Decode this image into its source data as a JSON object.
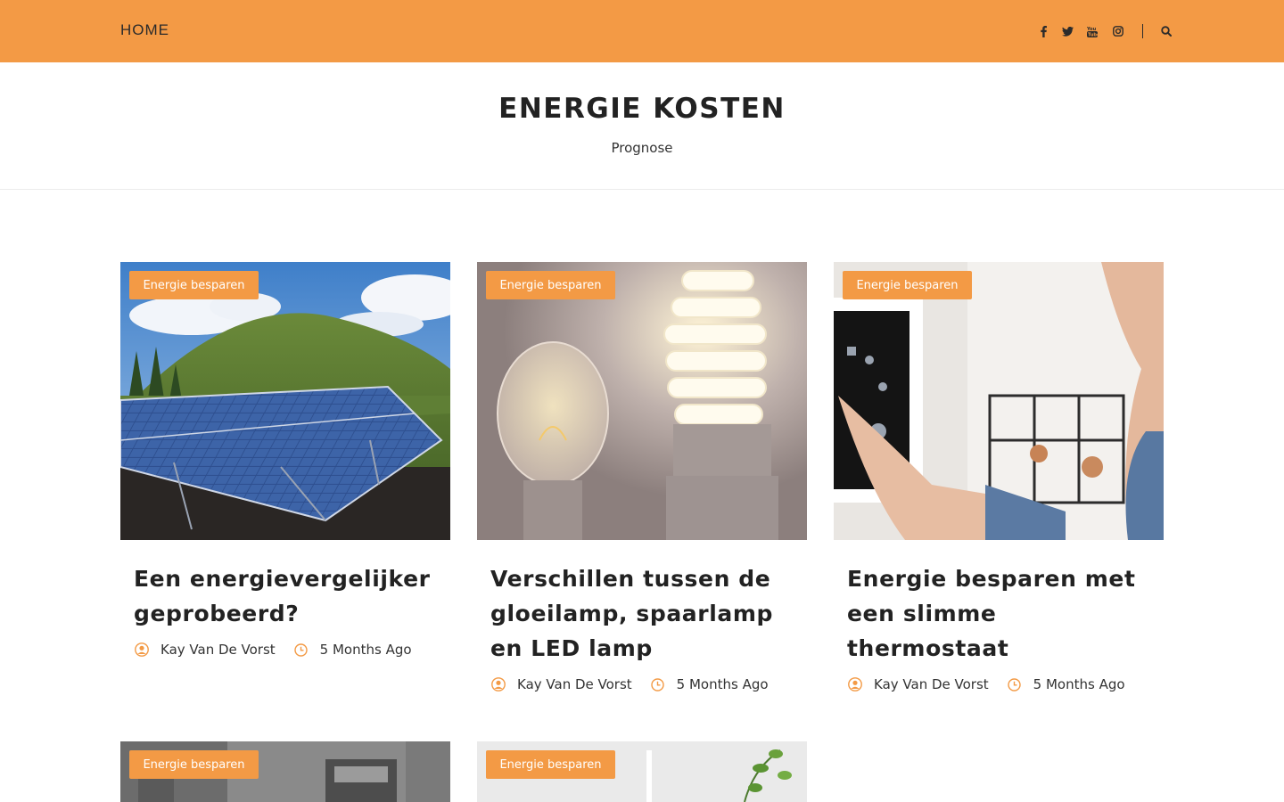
{
  "nav": {
    "home_label": "HOME",
    "social_icons": [
      "facebook-icon",
      "twitter-icon",
      "youtube-icon",
      "instagram-icon"
    ],
    "search_icon": "search-icon"
  },
  "header": {
    "title": "ENERGIE KOSTEN",
    "tagline": "Prognose"
  },
  "colors": {
    "accent": "#f39a45",
    "text": "#222222"
  },
  "posts": [
    {
      "category": "Energie besparen",
      "title": "Een energievergelijker geprobeerd?",
      "author": "Kay Van De Vorst",
      "date": "5 Months Ago"
    },
    {
      "category": "Energie besparen",
      "title": "Verschillen tussen de gloeilamp, spaarlamp en LED lamp",
      "author": "Kay Van De Vorst",
      "date": "5 Months Ago"
    },
    {
      "category": "Energie besparen",
      "title": "Energie besparen met een slimme thermostaat",
      "author": "Kay Van De Vorst",
      "date": "5 Months Ago"
    },
    {
      "category": "Energie besparen"
    },
    {
      "category": "Energie besparen"
    }
  ]
}
